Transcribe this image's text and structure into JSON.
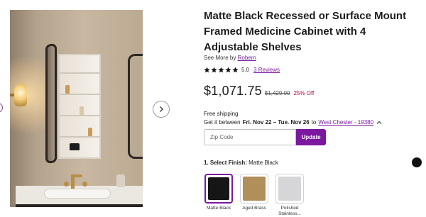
{
  "product": {
    "title": "Matte Black Recessed or Surface Mount Framed Medicine Cabinet with 4 Adjustable Shelves",
    "see_more_prefix": "See More by",
    "brand": "Robern",
    "rating_value": "5.0",
    "rating_stars": 5,
    "reviews_link": "3 Reviews",
    "price": "$1,071.75",
    "original_price": "$1,429.00",
    "discount": "25% Off"
  },
  "shipping": {
    "free_label": "Free shipping",
    "prefix": "Get it between",
    "date_range": "Fri. Nov 22 – Tue. Nov 26",
    "to_word": "to",
    "location": "West Chester - 19380",
    "chevron_icon": "chevron-up-icon"
  },
  "zip": {
    "placeholder": "Zip Code",
    "value": "",
    "button_label": "Update"
  },
  "finish": {
    "label_prefix": "1. Select Finish:",
    "selected": "Matte Black",
    "swatches": [
      {
        "label": "Matte Black",
        "color": "#161616",
        "selected": true
      },
      {
        "label": "Aged Brass",
        "color": "#b18f5a",
        "selected": false
      },
      {
        "label": "Polished Stainless...",
        "color": "#d6d6d8",
        "selected": false
      }
    ]
  },
  "gallery": {
    "next_icon": "chevron-right-icon"
  },
  "colors": {
    "accent": "#7b189f",
    "discount": "#b00a34",
    "star": "#111111"
  }
}
